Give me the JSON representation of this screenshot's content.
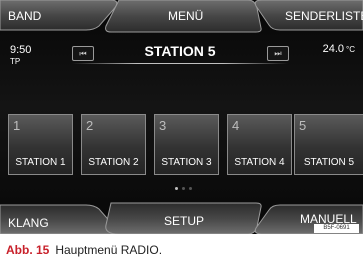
{
  "top_bar": {
    "band_label": "BAND",
    "menu_label": "MENÜ",
    "station_list_label": "SENDERLISTE"
  },
  "status": {
    "time": "9:50",
    "traffic": "TP",
    "temperature": "24.0",
    "temperature_unit": "°C"
  },
  "now_playing": {
    "station": "STATION 5",
    "prev_icon": "skip-back-icon",
    "next_icon": "skip-forward-icon"
  },
  "presets": [
    {
      "number": "1",
      "name": "STATION 1"
    },
    {
      "number": "2",
      "name": "STATION 2"
    },
    {
      "number": "3",
      "name": "STATION 3"
    },
    {
      "number": "4",
      "name": "STATION 4"
    },
    {
      "number": "5",
      "name": "STATION 5"
    }
  ],
  "pager": {
    "pages": 3,
    "active": 1
  },
  "bottom_bar": {
    "sound_label": "KLANG",
    "setup_label": "SETUP",
    "manual_label": "MANUELL"
  },
  "image_code": "B5F-0691",
  "caption": {
    "figure": "Abb. 15",
    "text": "Hauptmenü RADIO."
  }
}
